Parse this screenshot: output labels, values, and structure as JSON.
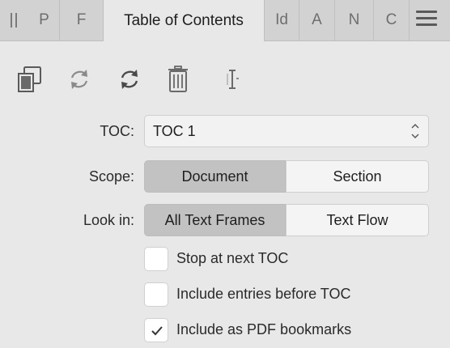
{
  "tabs": [
    {
      "label": "P"
    },
    {
      "label": "F"
    },
    {
      "label": "Table of Contents",
      "active": true
    },
    {
      "label": "Id"
    },
    {
      "label": "A"
    },
    {
      "label": "N"
    },
    {
      "label": "C"
    }
  ],
  "toolbar": {
    "icons": [
      "copy-icon",
      "refresh-icon",
      "sync-icon",
      "trash-icon",
      "text-cursor-icon"
    ]
  },
  "toc": {
    "label": "TOC:",
    "value": "TOC 1"
  },
  "scope": {
    "label": "Scope:",
    "options": [
      "Document",
      "Section"
    ],
    "selected": "Document"
  },
  "look_in": {
    "label": "Look in:",
    "options": [
      "All Text Frames",
      "Text Flow"
    ],
    "selected": "All Text Frames"
  },
  "checkboxes": [
    {
      "label": "Stop at next TOC",
      "checked": false
    },
    {
      "label": "Include entries before TOC",
      "checked": false
    },
    {
      "label": "Include as PDF bookmarks",
      "checked": true
    }
  ],
  "colors": {
    "panel_bg": "#e8e8e8",
    "tabbar_bg": "#d2d2d2",
    "segment_selected": "#c2c2c2"
  }
}
